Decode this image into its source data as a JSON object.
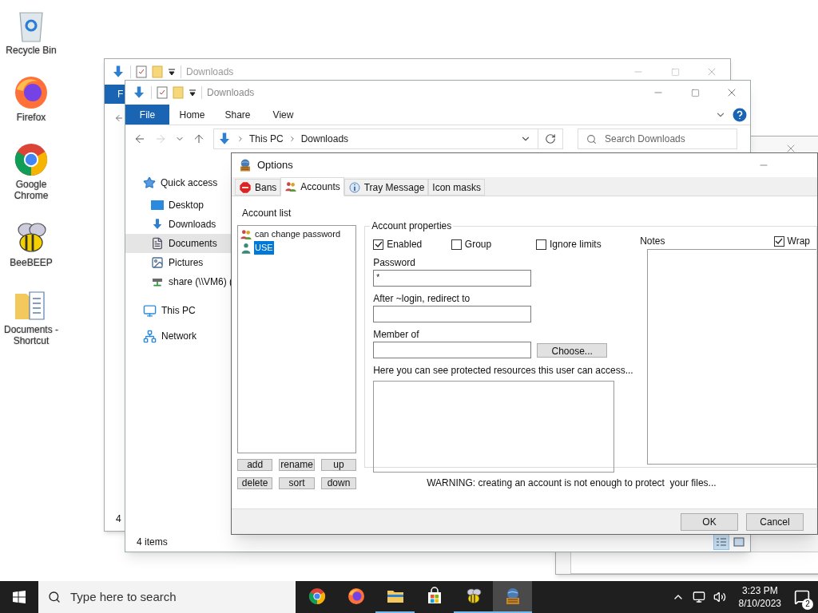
{
  "desktop_icons": [
    {
      "label": "Recycle Bin",
      "kind": "trash"
    },
    {
      "label": "Firefox",
      "kind": "firefox"
    },
    {
      "label": "Google Chrome",
      "kind": "chrome"
    },
    {
      "label": "BeeBEEP",
      "kind": "bee"
    },
    {
      "label": "Documents - Shortcut",
      "kind": "docs"
    }
  ],
  "back_explorer": {
    "title": "Downloads",
    "ribbon_tab": "F",
    "status": "4"
  },
  "explorer": {
    "title": "Downloads",
    "ribbon_tabs": [
      {
        "label": "File",
        "selected": true
      },
      {
        "label": "Home",
        "selected": false
      },
      {
        "label": "Share",
        "selected": false
      },
      {
        "label": "View",
        "selected": false
      }
    ],
    "address": [
      "This PC",
      "Downloads"
    ],
    "search": {
      "placeholder": "Search Downloads"
    },
    "nav": [
      {
        "label": "Quick access",
        "kind": "star",
        "selected": false,
        "children": [
          {
            "label": "Desktop",
            "kind": "desktop",
            "selected": false
          },
          {
            "label": "Downloads",
            "kind": "download",
            "selected": false
          },
          {
            "label": "Documents",
            "kind": "document",
            "selected": true
          },
          {
            "label": "Pictures",
            "kind": "pictures",
            "selected": false
          },
          {
            "label": "share (\\\\VM6) (",
            "kind": "share",
            "selected": false
          }
        ]
      },
      {
        "label": "This PC",
        "kind": "pc",
        "selected": false
      },
      {
        "label": "Network",
        "kind": "network",
        "selected": false
      }
    ],
    "status": "4 items"
  },
  "options": {
    "title": "Options",
    "tabs": [
      {
        "label": "Bans",
        "kind": "stop",
        "selected": false
      },
      {
        "label": "Accounts",
        "kind": "users",
        "selected": true
      },
      {
        "label": "Tray Message",
        "kind": "info",
        "selected": false
      },
      {
        "label": "Icon masks",
        "kind": "none",
        "selected": false
      }
    ],
    "account_list": {
      "label": "Account list",
      "items": [
        {
          "label": "can change password",
          "kind": "group",
          "selected": false
        },
        {
          "label": "USE",
          "kind": "user",
          "selected": true
        }
      ]
    },
    "list_buttons": [
      "add",
      "rename",
      "up",
      "delete",
      "sort",
      "down"
    ],
    "properties": {
      "title": "Account properties",
      "checkboxes": [
        {
          "label": "Enabled",
          "checked": true
        },
        {
          "label": "Group",
          "checked": false
        },
        {
          "label": "Ignore limits",
          "checked": false
        }
      ],
      "password": {
        "label": "Password",
        "value": "*"
      },
      "redirect": {
        "label": "After ~login, redirect to"
      },
      "member_of": {
        "label": "Member of",
        "button": "Choose..."
      },
      "resources": {
        "label": "Here you can see protected resources this user can access..."
      },
      "notes": {
        "label": "Notes",
        "wrap": {
          "label": "Wrap",
          "checked": true
        }
      }
    },
    "warning": "WARNING: creating an account is not enough to protect  your files...",
    "buttons": [
      "OK",
      "Cancel"
    ]
  },
  "taskbar": {
    "search": {
      "placeholder": "Type here to search"
    },
    "apps": [
      {
        "kind": "chrome",
        "running": false,
        "active": false
      },
      {
        "kind": "firefox",
        "running": false,
        "active": false
      },
      {
        "kind": "folder",
        "running": true,
        "active": false
      },
      {
        "kind": "store",
        "running": false,
        "active": false
      },
      {
        "kind": "bee",
        "running": true,
        "active": false
      },
      {
        "kind": "hfs",
        "running": true,
        "active": true
      }
    ],
    "time": "3:23 PM",
    "date": "8/10/2023",
    "notifications": "2"
  }
}
